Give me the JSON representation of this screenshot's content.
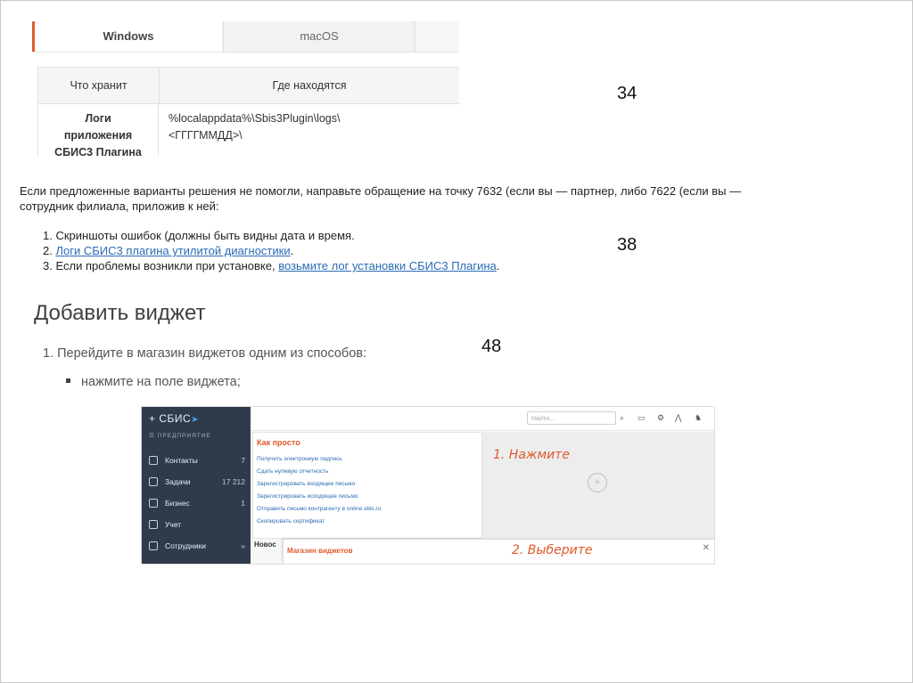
{
  "tabs": [
    "Windows",
    "macOS"
  ],
  "table": {
    "headers": [
      "Что хранит",
      "Где находятся"
    ],
    "row": {
      "what_lines": [
        "Логи",
        "приложения",
        "СБИС3 Плагина"
      ],
      "where_lines": [
        "%localappdata%\\Sbis3Plugin\\logs\\",
        "<ГГГГММДД>\\"
      ]
    }
  },
  "page_numbers": [
    "34",
    "38",
    "48"
  ],
  "block2": {
    "paragraph": "Если предложенные варианты решения не помогли, направьте обращение на точку 7632 (если вы — партнер, либо 7622 (если вы — сотрудник филиала, приложив к ней:",
    "items": [
      {
        "num": "1.",
        "text": "Скриншоты ошибок (должны быть видны дата и время.",
        "link": ""
      },
      {
        "num": "2.",
        "text": "",
        "link": "Логи СБИС3 плагина утилитой диагностики",
        "tail": "."
      },
      {
        "num": "3.",
        "text": "Если проблемы возникли при установке, ",
        "link": "возьмите лог установки СБИС3 Плагина",
        "tail": "."
      }
    ]
  },
  "block3": {
    "heading": "Добавить виджет",
    "step": "1. Перейдите в магазин виджетов одним из способов:",
    "bullet": "нажмите на поле виджета;"
  },
  "sbis": {
    "logo": "+ СБИС",
    "org": "ПРЕДПРИЯТИЕ",
    "nav": [
      {
        "label": "Контакты",
        "count": "7"
      },
      {
        "label": "Задачи",
        "count": "17 212"
      },
      {
        "label": "Бизнес",
        "count": "1"
      },
      {
        "label": "Учет",
        "count": ""
      },
      {
        "label": "Сотрудники",
        "count": "»"
      }
    ],
    "search_placeholder": "Найти...",
    "panel_title": "Как просто",
    "panel_items": [
      "Получить электронную подпись",
      "Сдать нулевую отчетность",
      "Зарегистрировать входящее письмо",
      "Зарегистрировать исходящее письмо",
      "Отправить письмо контрагенту в online.sbis.ru",
      "Скопировать сертификат"
    ],
    "hint1": "1. Нажмите",
    "hint2": "2. Выберите",
    "novo": "Новос",
    "shop_title": "Магазин виджетов",
    "close": "✕"
  },
  "colors": {
    "accent": "#e05a2b",
    "link": "#2a6bb5",
    "sidebar": "#2e3b4a"
  }
}
